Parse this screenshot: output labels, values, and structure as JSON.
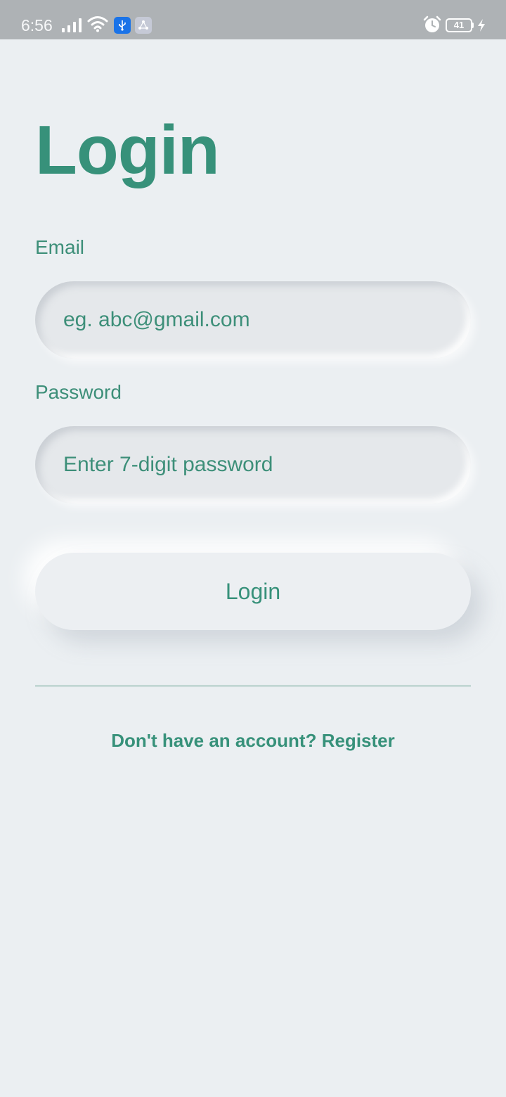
{
  "status_bar": {
    "time": "6:56",
    "battery_level": "41",
    "icons": [
      "signal-icon",
      "wifi-icon",
      "usb-icon",
      "share-icon",
      "alarm-icon",
      "battery-icon",
      "charging-icon"
    ]
  },
  "login": {
    "title": "Login",
    "email_label": "Email",
    "email_placeholder": "eg. abc@gmail.com",
    "password_label": "Password",
    "password_placeholder": "Enter 7-digit password",
    "button_label": "Login",
    "register_text": "Don't have an account? Register"
  },
  "colors": {
    "accent": "#37917a",
    "background": "#ebeff2",
    "status_bar": "#aeb2b5",
    "usb_badge": "#1a73e8"
  }
}
